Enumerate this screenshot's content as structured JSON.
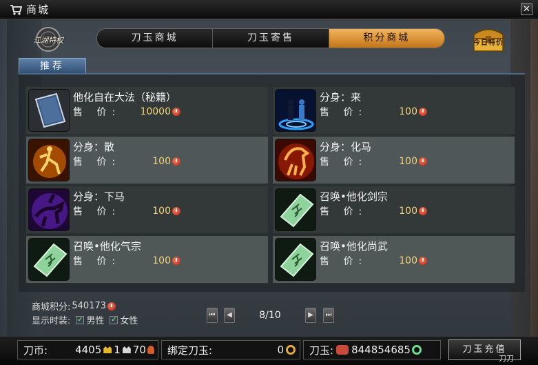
{
  "window": {
    "title": "商城"
  },
  "emblem": {
    "label": "江湖特权"
  },
  "tabs": [
    {
      "label": "刀玉商城",
      "active": false
    },
    {
      "label": "刀玉寄售",
      "active": false
    },
    {
      "label": "积分商城",
      "active": true
    }
  ],
  "chest": {
    "label": "今日特价"
  },
  "subtab": {
    "label": "推荐"
  },
  "price_label": "售  价:",
  "items": [
    {
      "name": "他化自在大法（秘籍）",
      "price": "10000",
      "icon": "book-icon"
    },
    {
      "name": "分身：来",
      "price": "100",
      "icon": "clone-summon-icon"
    },
    {
      "name": "分身：散",
      "price": "100",
      "icon": "clone-disperse-icon"
    },
    {
      "name": "分身：化马",
      "price": "100",
      "icon": "fire-horse-icon"
    },
    {
      "name": "分身：下马",
      "price": "100",
      "icon": "dismount-icon"
    },
    {
      "name": "召唤•他化剑宗",
      "price": "100",
      "icon": "scroll-icon"
    },
    {
      "name": "召唤•他化气宗",
      "price": "100",
      "icon": "scroll-icon"
    },
    {
      "name": "召唤•他化尚武",
      "price": "100",
      "icon": "scroll-icon"
    }
  ],
  "points": {
    "label": "商城积分:",
    "value": "540173"
  },
  "display": {
    "label": "显示时装:",
    "male": "男性",
    "female": "女性",
    "male_checked": true,
    "female_checked": true
  },
  "pager": {
    "text": "8/10"
  },
  "currency": {
    "coin_label": "刀币:",
    "gold": "4405",
    "silver": "1",
    "copper": "70",
    "bound_label": "绑定刀玉:",
    "bound_value": "0",
    "jade_label": "刀玉:",
    "jade_value": "844854685"
  },
  "recharge": {
    "label": "刀玉充值"
  },
  "corner_tag": "刀刀"
}
